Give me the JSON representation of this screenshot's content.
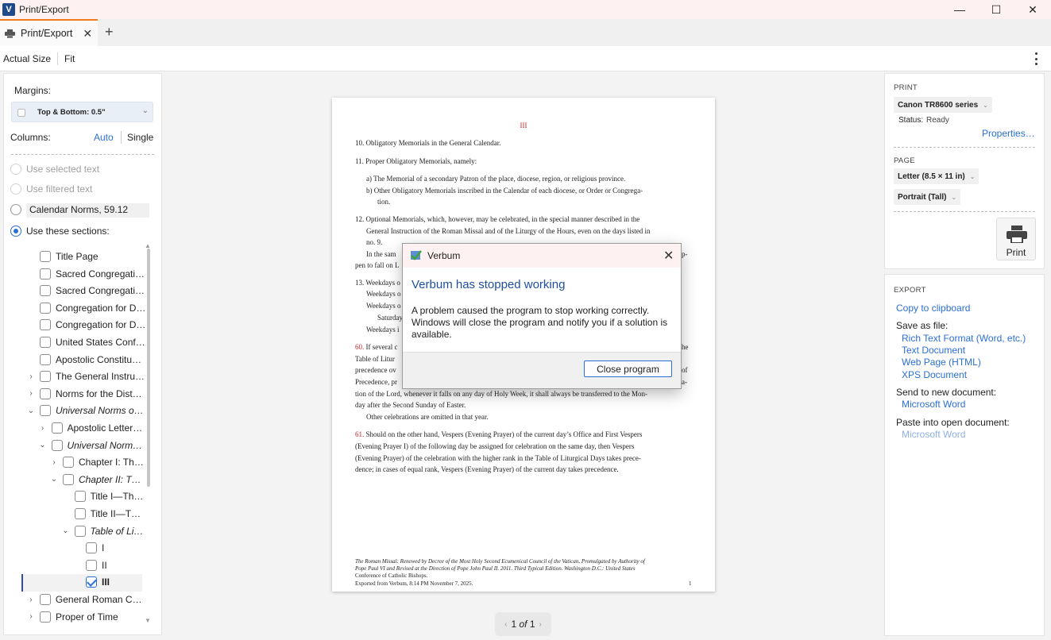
{
  "window": {
    "title": "Print/Export",
    "controls": {
      "minimize": "—",
      "maximize": "☐",
      "close": "✕"
    }
  },
  "tabs": [
    {
      "label": "Print/Export",
      "close": "✕",
      "icon": "printer-icon"
    }
  ],
  "toolbar": {
    "actual_size": "Actual Size",
    "fit": "Fit"
  },
  "left_panel": {
    "margins_label": "Margins:",
    "margins_value": "Top & Bottom: 0.5\"",
    "columns_label": "Columns:",
    "columns_auto": "Auto",
    "columns_single": "Single",
    "options": [
      {
        "label": "Use selected text",
        "state": "disabled"
      },
      {
        "label": "Use filtered text",
        "state": "disabled"
      },
      {
        "label": "Calendar Norms, 59.12",
        "state": "off"
      },
      {
        "label": "Use these sections:",
        "state": "on"
      }
    ],
    "tree": [
      {
        "label": "Title Page",
        "indent": 0,
        "twisty": "",
        "checked": false,
        "style": ""
      },
      {
        "label": "Sacred Congregati…",
        "indent": 0,
        "twisty": "",
        "checked": false,
        "style": ""
      },
      {
        "label": "Sacred Congregati…",
        "indent": 0,
        "twisty": "",
        "checked": false,
        "style": ""
      },
      {
        "label": "Congregation for D…",
        "indent": 0,
        "twisty": "",
        "checked": false,
        "style": ""
      },
      {
        "label": "Congregation for D…",
        "indent": 0,
        "twisty": "",
        "checked": false,
        "style": ""
      },
      {
        "label": "United States Conf…",
        "indent": 0,
        "twisty": "",
        "checked": false,
        "style": ""
      },
      {
        "label": "Apostolic Constitu…",
        "indent": 0,
        "twisty": "",
        "checked": false,
        "style": ""
      },
      {
        "label": "The General Instru…",
        "indent": 0,
        "twisty": "›",
        "checked": false,
        "style": ""
      },
      {
        "label": "Norms for the Dist…",
        "indent": 0,
        "twisty": "›",
        "checked": false,
        "style": ""
      },
      {
        "label": "Universal Norms o…",
        "indent": 0,
        "twisty": "⌄",
        "checked": false,
        "style": "it"
      },
      {
        "label": "Apostolic Letter…",
        "indent": 1,
        "twisty": "›",
        "checked": false,
        "style": ""
      },
      {
        "label": "Universal Norm…",
        "indent": 1,
        "twisty": "⌄",
        "checked": false,
        "style": "it"
      },
      {
        "label": "Chapter I: Th…",
        "indent": 2,
        "twisty": "›",
        "checked": false,
        "style": ""
      },
      {
        "label": "Chapter II: Th…",
        "indent": 2,
        "twisty": "⌄",
        "checked": false,
        "style": "it"
      },
      {
        "label": "Title I—Th…",
        "indent": 3,
        "twisty": "",
        "checked": false,
        "style": ""
      },
      {
        "label": "Title II—T…",
        "indent": 3,
        "twisty": "",
        "checked": false,
        "style": ""
      },
      {
        "label": "Table of Li…",
        "indent": 3,
        "twisty": "⌄",
        "checked": false,
        "style": "it"
      },
      {
        "label": "I",
        "indent": 4,
        "twisty": "",
        "checked": false,
        "style": ""
      },
      {
        "label": "II",
        "indent": 4,
        "twisty": "",
        "checked": false,
        "style": ""
      },
      {
        "label": "III",
        "indent": 4,
        "twisty": "",
        "checked": true,
        "style": "bold"
      },
      {
        "label": "General Roman Ca…",
        "indent": 0,
        "twisty": "›",
        "checked": false,
        "style": ""
      },
      {
        "label": "Proper of Time",
        "indent": 0,
        "twisty": "›",
        "checked": false,
        "style": ""
      }
    ]
  },
  "document": {
    "heading": "III",
    "lines": [
      {
        "t": "10. Obligatory Memorials in the General Calendar.",
        "red": ""
      },
      {
        "t": "11. Proper Obligatory Memorials, namely:",
        "red": ""
      },
      {
        "t": "a)  The Memorial of a secondary Patron of the place, diocese, region, or religious province.",
        "red": ""
      },
      {
        "t": "b)  Other Obligatory Memorials inscribed in the Calendar of each diocese, or Order or Congrega-",
        "red": ""
      },
      {
        "t": "tion.",
        "red": ""
      },
      {
        "t": "12. Optional Memorials, which, however, may be celebrated, in the special manner described in the",
        "red": ""
      },
      {
        "t": "General Instruction of the Roman Missal and of the Liturgy of the Hours, even on the days listed in",
        "red": ""
      },
      {
        "t": "no. 9.",
        "red": ""
      },
      {
        "t": "In the sam",
        "red": ""
      },
      {
        "t": "pen to fall on L",
        "red": ""
      },
      {
        "t": "13. Weekdays o",
        "red": ""
      },
      {
        "t": "Weekdays o",
        "red": ""
      },
      {
        "t": "Weekdays o",
        "red": ""
      },
      {
        "t": "Saturday",
        "red": ""
      },
      {
        "t": "Weekdays i",
        "red": ""
      },
      {
        "t": "If several c",
        "red": "60."
      },
      {
        "t": "Table of Litur",
        "red": ""
      },
      {
        "t": "precedence ov",
        "red": ""
      },
      {
        "t": "Precedence, pr",
        "red": ""
      },
      {
        "t": "tion of the Lord, whenever it falls on any day of Holy Week, it shall always be transferred to the Mon-",
        "red": ""
      },
      {
        "t": "day after the Second Sunday of Easter.",
        "red": ""
      },
      {
        "t": "Other celebrations are omitted in that year.",
        "red": ""
      },
      {
        "t": "Should on the other hand, Vespers (Evening Prayer) of the current day’s Office and First Vespers",
        "red": "61."
      },
      {
        "t": "(Evening Prayer I) of the following day be assigned for celebration on the same day, then Vespers",
        "red": ""
      },
      {
        "t": "(Evening Prayer) of the celebration with the higher rank in the Table of Liturgical Days takes prece-",
        "red": ""
      },
      {
        "t": "dence; in cases of equal rank, Vespers (Evening Prayer) of the current day takes precedence.",
        "red": ""
      }
    ],
    "right_fragments": [
      "p-",
      "he",
      "of",
      "a-"
    ],
    "footer_1": "The Roman Missal: Renewed by Decree of the Most Holy Second Ecumenical Council of the Vatican, Promulgated by Authority of",
    "footer_2": "Pope Paul VI and Revised at the Direction of Pope John Paul II. 2011. Third Typical Edition. Washington D.C.: United States",
    "footer_3": "Conference of Catholic Bishops.",
    "footer_4": "Exported from Verbum, 8:14 PM November 7, 2025.",
    "page_number": "1"
  },
  "pager": {
    "current": "1",
    "of": "of",
    "total": "1",
    "prev": "‹",
    "next": "›"
  },
  "dialog": {
    "title": "Verbum",
    "heading": "Verbum has stopped working",
    "message": "A problem caused the program to stop working correctly. Windows will close the program and notify you if a solution is available.",
    "button": "Close program"
  },
  "print_panel": {
    "header": "PRINT",
    "printer": "Canon TR8600 series",
    "status_label": "Status:",
    "status_value": "Ready",
    "properties": "Properties…",
    "page_header": "PAGE",
    "paper": "Letter (8.5 × 11 in)",
    "orientation": "Portrait (Tall)",
    "print_button": "Print"
  },
  "export_panel": {
    "header": "EXPORT",
    "copy": "Copy to clipboard",
    "save_label": "Save as file:",
    "save_options": [
      "Rich Text Format (Word, etc.)",
      "Text Document",
      "Web Page (HTML)",
      "XPS Document"
    ],
    "send_label": "Send to new document:",
    "send_word": "Microsoft Word",
    "paste_label": "Paste into open document:",
    "paste_word": "Microsoft Word"
  },
  "colors": {
    "accent": "#2b6fd6",
    "tab_accent": "#f07c22",
    "rubric_red": "#c62828",
    "annotation_red": "#d01818"
  }
}
